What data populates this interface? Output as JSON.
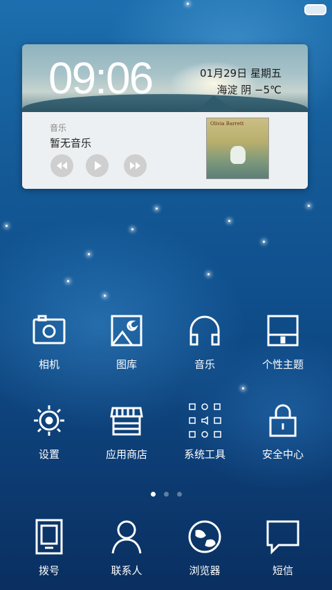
{
  "status_bar": {
    "battery_icon": "battery-icon"
  },
  "widget": {
    "time": "09:06",
    "date_line": "01月29日  星期五",
    "weather_line": "海淀  阴  −5℃",
    "music": {
      "label": "音乐",
      "title": "暂无音乐",
      "controls": [
        "previous-icon",
        "play-icon",
        "next-icon"
      ],
      "album_text": "Olivia Barrett"
    }
  },
  "apps_page": [
    {
      "label": "相机",
      "icon": "camera-icon"
    },
    {
      "label": "图库",
      "icon": "gallery-icon"
    },
    {
      "label": "音乐",
      "icon": "headphones-icon"
    },
    {
      "label": "个性主题",
      "icon": "theme-icon"
    },
    {
      "label": "设置",
      "icon": "gear-icon"
    },
    {
      "label": "应用商店",
      "icon": "store-icon"
    },
    {
      "label": "系统工具",
      "icon": "tools-folder-icon"
    },
    {
      "label": "安全中心",
      "icon": "lock-icon"
    }
  ],
  "page_indicator": {
    "count": 3,
    "active": 0
  },
  "dock": [
    {
      "label": "拨号",
      "icon": "phone-icon"
    },
    {
      "label": "联系人",
      "icon": "contact-icon"
    },
    {
      "label": "浏览器",
      "icon": "globe-icon"
    },
    {
      "label": "短信",
      "icon": "message-icon"
    }
  ]
}
